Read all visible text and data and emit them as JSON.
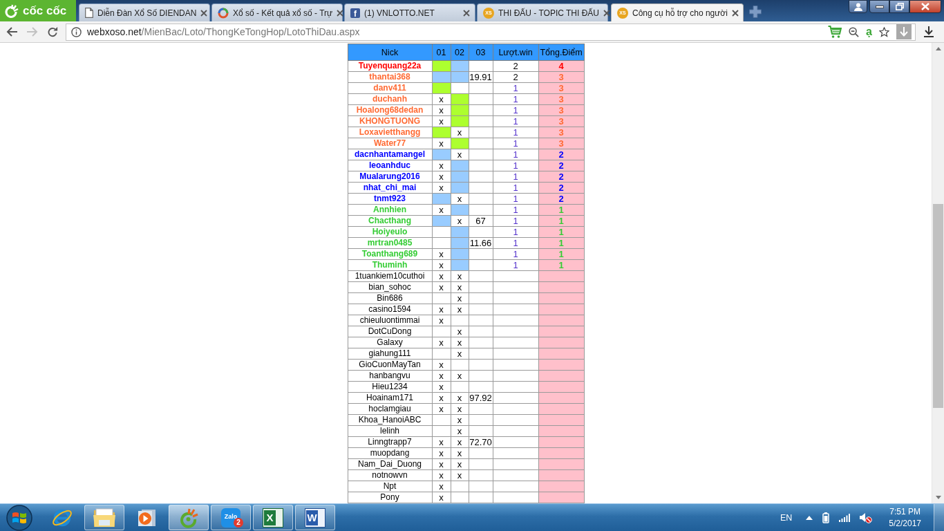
{
  "browser": {
    "name": "cốc cốc",
    "tabs": [
      {
        "title": "Diễn Đàn Xổ Số DIENDAN",
        "kind": "page",
        "selected": false
      },
      {
        "title": "Xổ số - Kết quả xổ số - Trự",
        "kind": "ring",
        "selected": false
      },
      {
        "title": "(1) VNLOTTO.NET",
        "kind": "social",
        "badge": "f",
        "selected": false
      },
      {
        "title": "THI ĐẤU - TOPIC THI ĐẤU",
        "kind": "site",
        "badge": "XS",
        "selected": false
      },
      {
        "title": "Công cụ hỗ trợ cho người",
        "kind": "site",
        "badge": "XS",
        "selected": true
      }
    ]
  },
  "address_bar": {
    "host": "webxoso.net",
    "path": "/MienBac/Loto/ThongKeTongHop/LotoThiDau.aspx",
    "dictionary_glyph": "ạ"
  },
  "table": {
    "columns": [
      "Nick",
      "01",
      "02",
      "03",
      "Lượt.win",
      "Tổng.Điểm"
    ],
    "rows": [
      {
        "nick": "Tuyenquang22a",
        "color": "#ff0000",
        "picks": [
          {
            "kind": "fill",
            "color": "#adff2f"
          },
          {
            "kind": "fill",
            "color": "#99ccff"
          },
          {
            "kind": "empty"
          }
        ],
        "wins": {
          "text": "2",
          "color": "#000000"
        },
        "points": "4"
      },
      {
        "nick": "thantai368",
        "color": "#ff6a33",
        "picks": [
          {
            "kind": "fill",
            "color": "#99ccff"
          },
          {
            "kind": "fill",
            "color": "#99ccff"
          },
          {
            "kind": "mark",
            "text": "19.91"
          }
        ],
        "wins": {
          "text": "2",
          "color": "#000000"
        },
        "points": "3"
      },
      {
        "nick": "danv411",
        "color": "#ff6a33",
        "picks": [
          {
            "kind": "fill",
            "color": "#adff2f"
          },
          {
            "kind": "empty"
          },
          {
            "kind": "empty"
          }
        ],
        "wins": {
          "text": "1",
          "color": "#5533cc"
        },
        "points": "3"
      },
      {
        "nick": "duchanh",
        "color": "#ff6a33",
        "picks": [
          {
            "kind": "mark",
            "text": "x"
          },
          {
            "kind": "fill",
            "color": "#adff2f"
          },
          {
            "kind": "empty"
          }
        ],
        "wins": {
          "text": "1",
          "color": "#5533cc"
        },
        "points": "3"
      },
      {
        "nick": "Hoalong68dedan",
        "color": "#ff6a33",
        "picks": [
          {
            "kind": "mark",
            "text": "x"
          },
          {
            "kind": "fill",
            "color": "#adff2f"
          },
          {
            "kind": "empty"
          }
        ],
        "wins": {
          "text": "1",
          "color": "#5533cc"
        },
        "points": "3"
      },
      {
        "nick": "KHONGTUONG",
        "color": "#ff6a33",
        "picks": [
          {
            "kind": "mark",
            "text": "x"
          },
          {
            "kind": "fill",
            "color": "#adff2f"
          },
          {
            "kind": "empty"
          }
        ],
        "wins": {
          "text": "1",
          "color": "#5533cc"
        },
        "points": "3"
      },
      {
        "nick": "Loxavietthangg",
        "color": "#ff6a33",
        "picks": [
          {
            "kind": "fill",
            "color": "#adff2f"
          },
          {
            "kind": "mark",
            "text": "x"
          },
          {
            "kind": "empty"
          }
        ],
        "wins": {
          "text": "1",
          "color": "#5533cc"
        },
        "points": "3"
      },
      {
        "nick": "Water77",
        "color": "#ff6a33",
        "picks": [
          {
            "kind": "mark",
            "text": "x"
          },
          {
            "kind": "fill",
            "color": "#adff2f"
          },
          {
            "kind": "empty"
          }
        ],
        "wins": {
          "text": "1",
          "color": "#5533cc"
        },
        "points": "3"
      },
      {
        "nick": "dacnhantamangel",
        "color": "#0000ff",
        "picks": [
          {
            "kind": "fill",
            "color": "#99ccff"
          },
          {
            "kind": "mark",
            "text": "x"
          },
          {
            "kind": "empty"
          }
        ],
        "wins": {
          "text": "1",
          "color": "#5533cc"
        },
        "points": "2"
      },
      {
        "nick": "leoanhduc",
        "color": "#0000ff",
        "picks": [
          {
            "kind": "mark",
            "text": "x"
          },
          {
            "kind": "fill",
            "color": "#99ccff"
          },
          {
            "kind": "empty"
          }
        ],
        "wins": {
          "text": "1",
          "color": "#5533cc"
        },
        "points": "2"
      },
      {
        "nick": "Mualarung2016",
        "color": "#0000ff",
        "picks": [
          {
            "kind": "mark",
            "text": "x"
          },
          {
            "kind": "fill",
            "color": "#99ccff"
          },
          {
            "kind": "empty"
          }
        ],
        "wins": {
          "text": "1",
          "color": "#5533cc"
        },
        "points": "2"
      },
      {
        "nick": "nhat_chi_mai",
        "color": "#0000ff",
        "picks": [
          {
            "kind": "mark",
            "text": "x"
          },
          {
            "kind": "fill",
            "color": "#99ccff"
          },
          {
            "kind": "empty"
          }
        ],
        "wins": {
          "text": "1",
          "color": "#5533cc"
        },
        "points": "2"
      },
      {
        "nick": "tnmt923",
        "color": "#0000ff",
        "picks": [
          {
            "kind": "fill",
            "color": "#99ccff"
          },
          {
            "kind": "mark",
            "text": "x"
          },
          {
            "kind": "empty"
          }
        ],
        "wins": {
          "text": "1",
          "color": "#5533cc"
        },
        "points": "2"
      },
      {
        "nick": "Annhien",
        "color": "#33cc33",
        "picks": [
          {
            "kind": "mark",
            "text": "x"
          },
          {
            "kind": "fill",
            "color": "#99ccff"
          },
          {
            "kind": "empty"
          }
        ],
        "wins": {
          "text": "1",
          "color": "#5533cc"
        },
        "points": "1"
      },
      {
        "nick": "Chacthang",
        "color": "#33cc33",
        "picks": [
          {
            "kind": "fill",
            "color": "#99ccff"
          },
          {
            "kind": "mark",
            "text": "x"
          },
          {
            "kind": "mark",
            "text": "67"
          }
        ],
        "wins": {
          "text": "1",
          "color": "#5533cc"
        },
        "points": "1"
      },
      {
        "nick": "Hoiyeulo",
        "color": "#33cc33",
        "picks": [
          {
            "kind": "empty"
          },
          {
            "kind": "fill",
            "color": "#99ccff"
          },
          {
            "kind": "empty"
          }
        ],
        "wins": {
          "text": "1",
          "color": "#5533cc"
        },
        "points": "1"
      },
      {
        "nick": "mrtran0485",
        "color": "#33cc33",
        "picks": [
          {
            "kind": "empty"
          },
          {
            "kind": "fill",
            "color": "#99ccff"
          },
          {
            "kind": "mark",
            "text": "11.66"
          }
        ],
        "wins": {
          "text": "1",
          "color": "#5533cc"
        },
        "points": "1"
      },
      {
        "nick": "Toanthang689",
        "color": "#33cc33",
        "picks": [
          {
            "kind": "mark",
            "text": "x"
          },
          {
            "kind": "fill",
            "color": "#99ccff"
          },
          {
            "kind": "empty"
          }
        ],
        "wins": {
          "text": "1",
          "color": "#5533cc"
        },
        "points": "1"
      },
      {
        "nick": "Thuminh",
        "color": "#33cc33",
        "picks": [
          {
            "kind": "mark",
            "text": "x"
          },
          {
            "kind": "fill",
            "color": "#99ccff"
          },
          {
            "kind": "empty"
          }
        ],
        "wins": {
          "text": "1",
          "color": "#5533cc"
        },
        "points": "1"
      },
      {
        "nick": "1tuankiem10cuthoi",
        "color": "#000000",
        "picks": [
          {
            "kind": "mark",
            "text": "x"
          },
          {
            "kind": "mark",
            "text": "x"
          },
          {
            "kind": "empty"
          }
        ]
      },
      {
        "nick": "bian_sohoc",
        "color": "#000000",
        "picks": [
          {
            "kind": "mark",
            "text": "x"
          },
          {
            "kind": "mark",
            "text": "x"
          },
          {
            "kind": "empty"
          }
        ]
      },
      {
        "nick": "Bin686",
        "color": "#000000",
        "picks": [
          {
            "kind": "empty"
          },
          {
            "kind": "mark",
            "text": "x"
          },
          {
            "kind": "empty"
          }
        ]
      },
      {
        "nick": "casino1594",
        "color": "#000000",
        "picks": [
          {
            "kind": "mark",
            "text": "x"
          },
          {
            "kind": "mark",
            "text": "x"
          },
          {
            "kind": "empty"
          }
        ]
      },
      {
        "nick": "chieuluontimmai",
        "color": "#000000",
        "picks": [
          {
            "kind": "mark",
            "text": "x"
          },
          {
            "kind": "empty"
          },
          {
            "kind": "empty"
          }
        ]
      },
      {
        "nick": "DotCuDong",
        "color": "#000000",
        "picks": [
          {
            "kind": "empty"
          },
          {
            "kind": "mark",
            "text": "x"
          },
          {
            "kind": "empty"
          }
        ]
      },
      {
        "nick": "Galaxy",
        "color": "#000000",
        "picks": [
          {
            "kind": "mark",
            "text": "x"
          },
          {
            "kind": "mark",
            "text": "x"
          },
          {
            "kind": "empty"
          }
        ]
      },
      {
        "nick": "giahung111",
        "color": "#000000",
        "picks": [
          {
            "kind": "empty"
          },
          {
            "kind": "mark",
            "text": "x"
          },
          {
            "kind": "empty"
          }
        ]
      },
      {
        "nick": "GioCuonMayTan",
        "color": "#000000",
        "picks": [
          {
            "kind": "mark",
            "text": "x"
          },
          {
            "kind": "empty"
          },
          {
            "kind": "empty"
          }
        ]
      },
      {
        "nick": "hanbangvu",
        "color": "#000000",
        "picks": [
          {
            "kind": "mark",
            "text": "x"
          },
          {
            "kind": "mark",
            "text": "x"
          },
          {
            "kind": "empty"
          }
        ]
      },
      {
        "nick": "Hieu1234",
        "color": "#000000",
        "picks": [
          {
            "kind": "mark",
            "text": "x"
          },
          {
            "kind": "empty"
          },
          {
            "kind": "empty"
          }
        ]
      },
      {
        "nick": "Hoainam171",
        "color": "#000000",
        "picks": [
          {
            "kind": "mark",
            "text": "x"
          },
          {
            "kind": "mark",
            "text": "x"
          },
          {
            "kind": "mark",
            "text": "97.92"
          }
        ]
      },
      {
        "nick": "hoclamgiau",
        "color": "#000000",
        "picks": [
          {
            "kind": "mark",
            "text": "x"
          },
          {
            "kind": "mark",
            "text": "x"
          },
          {
            "kind": "empty"
          }
        ]
      },
      {
        "nick": "Khoa_HanoiABC",
        "color": "#000000",
        "picks": [
          {
            "kind": "empty"
          },
          {
            "kind": "mark",
            "text": "x"
          },
          {
            "kind": "empty"
          }
        ]
      },
      {
        "nick": "lelinh",
        "color": "#000000",
        "picks": [
          {
            "kind": "empty"
          },
          {
            "kind": "mark",
            "text": "x"
          },
          {
            "kind": "empty"
          }
        ]
      },
      {
        "nick": "Linngtrapp7",
        "color": "#000000",
        "picks": [
          {
            "kind": "mark",
            "text": "x"
          },
          {
            "kind": "mark",
            "text": "x"
          },
          {
            "kind": "mark",
            "text": "72.70"
          }
        ]
      },
      {
        "nick": "muopdang",
        "color": "#000000",
        "picks": [
          {
            "kind": "mark",
            "text": "x"
          },
          {
            "kind": "mark",
            "text": "x"
          },
          {
            "kind": "empty"
          }
        ]
      },
      {
        "nick": "Nam_Dai_Duong",
        "color": "#000000",
        "picks": [
          {
            "kind": "mark",
            "text": "x"
          },
          {
            "kind": "mark",
            "text": "x"
          },
          {
            "kind": "empty"
          }
        ]
      },
      {
        "nick": "notnowvn",
        "color": "#000000",
        "picks": [
          {
            "kind": "mark",
            "text": "x"
          },
          {
            "kind": "mark",
            "text": "x"
          },
          {
            "kind": "empty"
          }
        ]
      },
      {
        "nick": "Npt",
        "color": "#000000",
        "picks": [
          {
            "kind": "mark",
            "text": "x"
          },
          {
            "kind": "empty"
          },
          {
            "kind": "empty"
          }
        ]
      },
      {
        "nick": "Pony",
        "color": "#000000",
        "picks": [
          {
            "kind": "mark",
            "text": "x"
          },
          {
            "kind": "empty"
          },
          {
            "kind": "empty"
          }
        ]
      }
    ]
  },
  "taskbar": {
    "apps": [
      {
        "kind": "web",
        "running": false,
        "active": false
      },
      {
        "kind": "folder",
        "running": true,
        "active": false
      },
      {
        "kind": "media",
        "running": false,
        "active": false
      },
      {
        "kind": "ring",
        "running": true,
        "active": true
      },
      {
        "kind": "chat",
        "label": "Zalo",
        "badge": "2",
        "running": true,
        "active": false
      },
      {
        "kind": "sheet",
        "glyph": "X",
        "running": true,
        "active": false
      },
      {
        "kind": "doc",
        "glyph": "W",
        "running": true,
        "active": false
      }
    ],
    "tray": {
      "language": "EN",
      "muted": true,
      "time": "7:51 PM",
      "date": "5/2/2017"
    }
  }
}
